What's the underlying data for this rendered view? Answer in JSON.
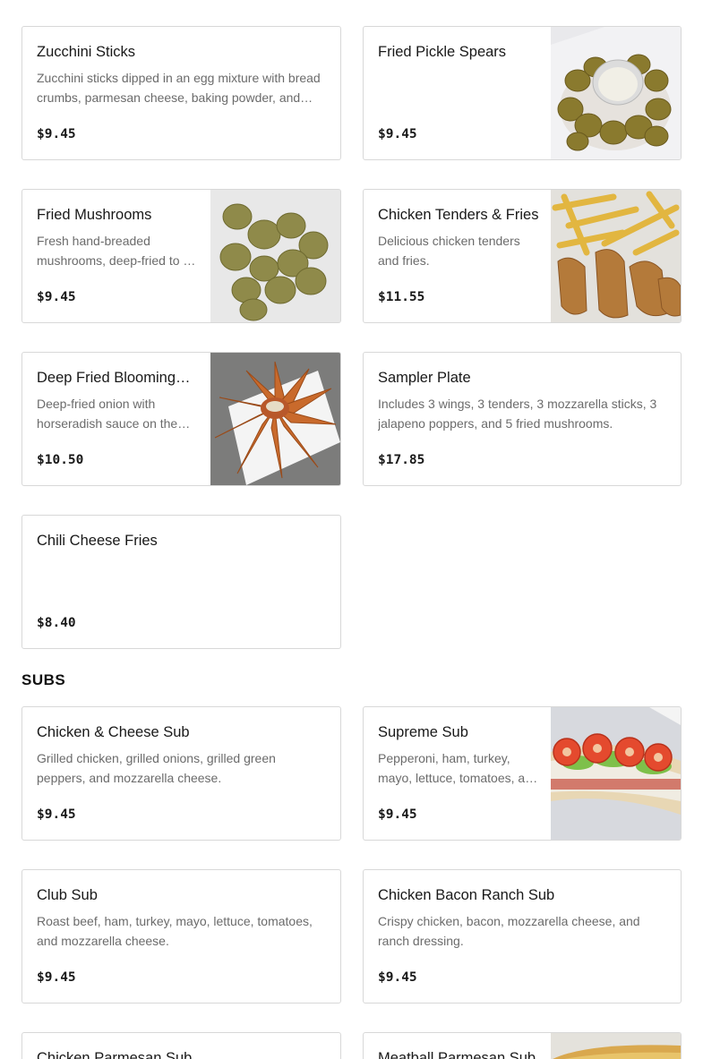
{
  "appetizers": {
    "items": [
      {
        "name": "Zucchini Sticks",
        "description": "Zucchini sticks dipped in an egg mixture with bread crumbs, parmesan cheese, baking powder, and fried golden brown.",
        "price": "$9.45",
        "image": "none"
      },
      {
        "name": "Fried Pickle Spears",
        "description": "",
        "price": "$9.45",
        "image": "fried-pickles-photo"
      },
      {
        "name": "Fried Mushrooms",
        "description": "Fresh hand-breaded mushrooms, deep-fried to a golden crisp.",
        "price": "$9.45",
        "image": "fried-mushrooms-photo"
      },
      {
        "name": "Chicken Tenders & Fries",
        "description": "Delicious chicken tenders and fries.",
        "price": "$11.55",
        "image": "chicken-tenders-fries-photo"
      },
      {
        "name": "Deep Fried Blooming Onion",
        "description": "Deep-fried onion with horseradish sauce on the side.",
        "price": "$10.50",
        "image": "blooming-onion-photo"
      },
      {
        "name": "Sampler Plate",
        "description": "Includes 3 wings, 3 tenders, 3 mozzarella sticks, 3 jalapeno poppers, and 5 fried mushrooms.",
        "price": "$17.85",
        "image": "none"
      },
      {
        "name": "Chili Cheese Fries",
        "description": "",
        "price": "$8.40",
        "image": "none"
      }
    ]
  },
  "subs": {
    "title": "SUBS",
    "items": [
      {
        "name": "Chicken & Cheese Sub",
        "description": "Grilled chicken, grilled onions, grilled green peppers, and mozzarella cheese.",
        "price": "$9.45",
        "image": "none"
      },
      {
        "name": "Supreme Sub",
        "description": "Pepperoni, ham, turkey, mayo, lettuce, tomatoes, and mozzarella cheese.",
        "price": "$9.45",
        "image": "supreme-sub-photo"
      },
      {
        "name": "Club Sub",
        "description": "Roast beef, ham, turkey, mayo, lettuce, tomatoes, and mozzarella cheese.",
        "price": "$9.45",
        "image": "none"
      },
      {
        "name": "Chicken Bacon Ranch Sub",
        "description": "Crispy chicken, bacon, mozzarella cheese, and ranch dressing.",
        "price": "$9.45",
        "image": "none"
      },
      {
        "name": "Chicken Parmesan Sub",
        "description": "",
        "price": "",
        "image": "none"
      },
      {
        "name": "Meatball Parmesan Sub",
        "description": "",
        "price": "",
        "image": "meatball-sub-photo"
      }
    ]
  }
}
